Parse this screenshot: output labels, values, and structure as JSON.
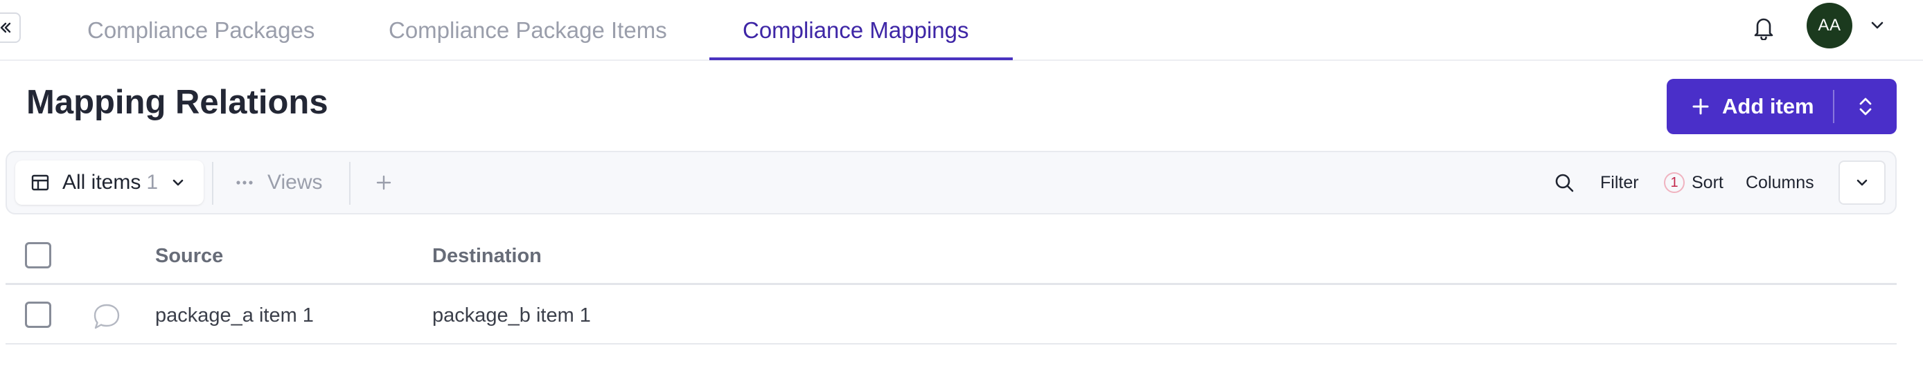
{
  "nav": {
    "tabs": [
      {
        "label": "Compliance Packages",
        "active": false
      },
      {
        "label": "Compliance Package Items",
        "active": false
      },
      {
        "label": "Compliance Mappings",
        "active": true
      }
    ],
    "avatar_initials": "AA"
  },
  "header": {
    "title": "Mapping Relations",
    "add_button_label": "Add item"
  },
  "toolbar": {
    "view_label": "All items",
    "view_count": "1",
    "views_label": "Views",
    "filter_label": "Filter",
    "sort_count": "1",
    "sort_label": "Sort",
    "columns_label": "Columns"
  },
  "table": {
    "columns": [
      "Source",
      "Destination"
    ],
    "rows": [
      {
        "source": "package_a item 1",
        "destination": "package_b item 1"
      }
    ]
  },
  "icons": {
    "collapse": "collapse-chevrons-icon",
    "bell": "bell-icon",
    "account_menu": "chevron-down-icon",
    "add": "plus-icon",
    "add_options": "chevrons-up-down-icon",
    "view": "table-grid-icon",
    "views": "ellipsis-icon",
    "new_view": "plus-icon",
    "search": "search-icon",
    "more": "chevron-down-icon",
    "comment": "comment-bubble-icon"
  },
  "colors": {
    "accent": "#4a2fc9",
    "active_tab": "#3e26a6",
    "avatar_bg": "#1b3a1e",
    "muted_text": "#9a9eab",
    "sort_badge": "#c2264a"
  }
}
